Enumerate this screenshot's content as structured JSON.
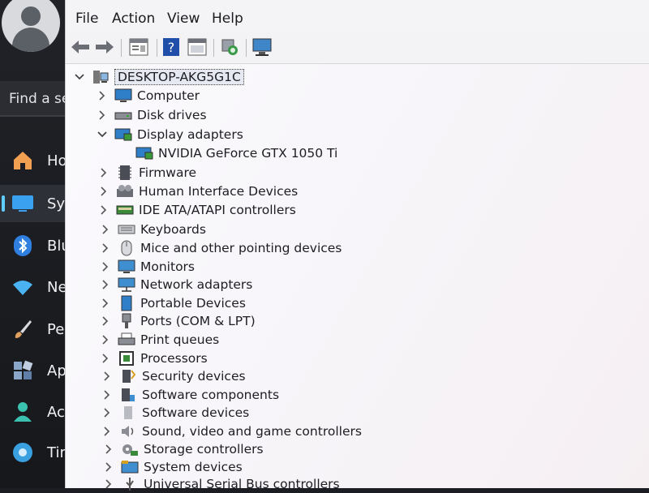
{
  "settings_panel": {
    "search_text": "Find a se",
    "nav": [
      {
        "label": "Ho",
        "icon": "home-icon",
        "color": "#f0a050"
      },
      {
        "label": "Sys",
        "icon": "monitor-icon",
        "color": "#3aa0f0",
        "active": true
      },
      {
        "label": "Blu",
        "icon": "bluetooth-icon",
        "color": "#2f7fe0"
      },
      {
        "label": "Ne",
        "icon": "wifi-icon",
        "color": "#4ab2f0"
      },
      {
        "label": "Per",
        "icon": "brush-icon",
        "color": "#e0a060"
      },
      {
        "label": "Ap",
        "icon": "apps-icon",
        "color": "#8aa6c8"
      },
      {
        "label": "Acc",
        "icon": "person-icon",
        "color": "#3bc1b0"
      },
      {
        "label": "Tim",
        "icon": "globe-icon",
        "color": "#3aa0e0"
      }
    ]
  },
  "device_manager": {
    "menu": [
      "File",
      "Action",
      "View",
      "Help"
    ],
    "toolbar": [
      "back-arrow-icon",
      "forward-arrow-icon",
      "properties-icon",
      "help-icon",
      "update-driver-icon",
      "scan-hardware-icon",
      "display-device-icon"
    ],
    "root": "DESKTOP-AKG5G1C",
    "tree": [
      {
        "label": "Computer",
        "icon": "computer-icon",
        "expanded": false
      },
      {
        "label": "Disk drives",
        "icon": "disk-drive-icon",
        "expanded": false
      },
      {
        "label": "Display adapters",
        "icon": "display-adapter-icon",
        "expanded": true
      },
      {
        "label": "NVIDIA GeForce GTX 1050 Ti",
        "icon": "display-adapter-icon",
        "child": true
      },
      {
        "label": "Firmware",
        "icon": "firmware-icon",
        "expanded": false
      },
      {
        "label": "Human Interface Devices",
        "icon": "hid-icon",
        "expanded": false
      },
      {
        "label": "IDE ATA/ATAPI controllers",
        "icon": "ide-controller-icon",
        "expanded": false
      },
      {
        "label": "Keyboards",
        "icon": "keyboard-icon",
        "expanded": false
      },
      {
        "label": "Mice and other pointing devices",
        "icon": "mouse-icon",
        "expanded": false
      },
      {
        "label": "Monitors",
        "icon": "monitor-icon",
        "expanded": false
      },
      {
        "label": "Network adapters",
        "icon": "network-adapter-icon",
        "expanded": false
      },
      {
        "label": "Portable Devices",
        "icon": "portable-device-icon",
        "expanded": false
      },
      {
        "label": "Ports (COM & LPT)",
        "icon": "port-icon",
        "expanded": false
      },
      {
        "label": "Print queues",
        "icon": "printer-icon",
        "expanded": false
      },
      {
        "label": "Processors",
        "icon": "processor-icon",
        "expanded": false
      },
      {
        "label": "Security devices",
        "icon": "security-device-icon",
        "expanded": false
      },
      {
        "label": "Software components",
        "icon": "software-component-icon",
        "expanded": false
      },
      {
        "label": "Software devices",
        "icon": "software-device-icon",
        "expanded": false
      },
      {
        "label": "Sound, video and game controllers",
        "icon": "sound-icon",
        "expanded": false
      },
      {
        "label": "Storage controllers",
        "icon": "storage-controller-icon",
        "expanded": false
      },
      {
        "label": "System devices",
        "icon": "system-device-icon",
        "expanded": false
      },
      {
        "label": "Universal Serial Bus controllers",
        "icon": "usb-icon",
        "expanded": false
      }
    ]
  }
}
